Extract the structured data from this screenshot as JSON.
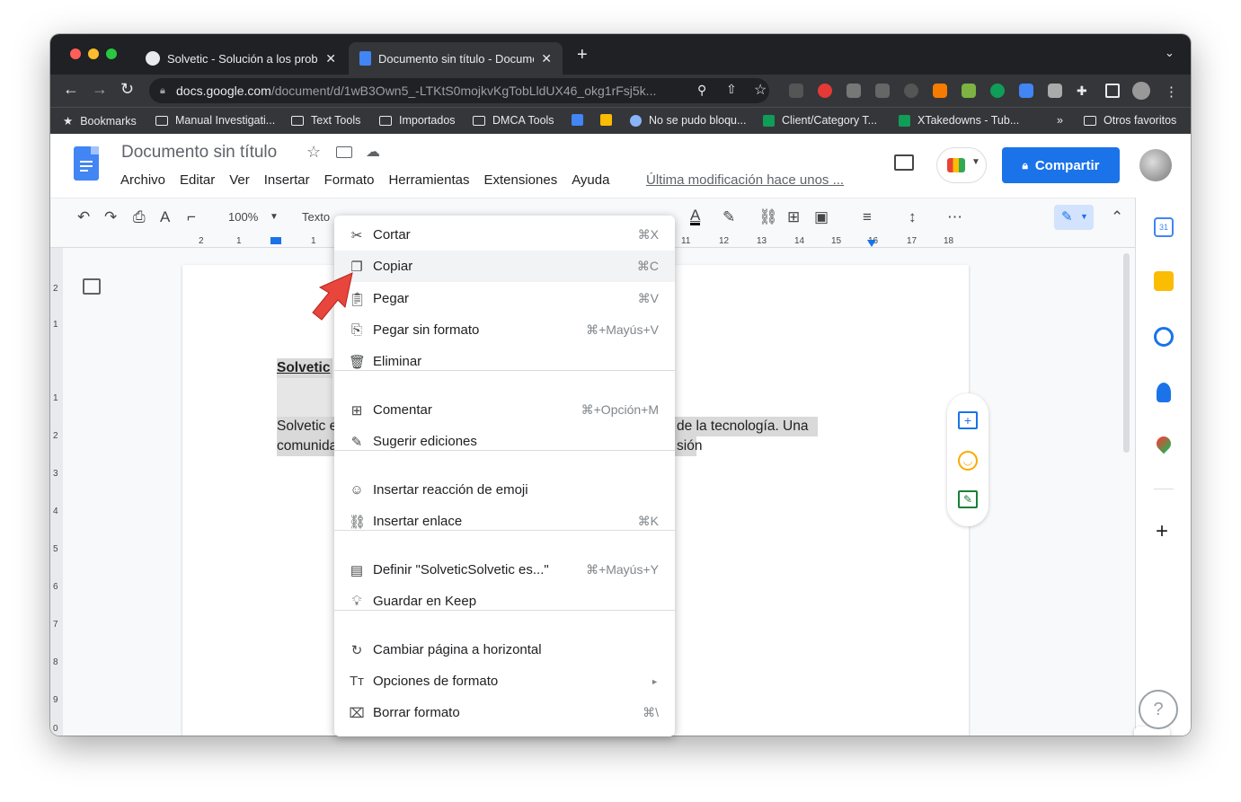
{
  "tabs": [
    {
      "label": "Solvetic - Solución a los proble"
    },
    {
      "label": "Documento sin título - Docume"
    }
  ],
  "address": {
    "host": "docs.google.com",
    "path": "/document/d/1wB3Own5_-LTKtS0mojkvKgTobLldUX46_okg1rFsj5k..."
  },
  "bookmarks": [
    "Bookmarks",
    "Manual Investigati...",
    "Text Tools",
    "Importados",
    "DMCA Tools",
    "No se pudo bloqu...",
    "Client/Category T...",
    "XTakedowns - Tub...",
    "»",
    "Otros favoritos"
  ],
  "doc": {
    "title": "Documento sin título",
    "menus": [
      "Archivo",
      "Editar",
      "Ver",
      "Insertar",
      "Formato",
      "Herramientas",
      "Extensiones",
      "Ayuda"
    ],
    "last_modified": "Última modificación hace unos ...",
    "share": "Compartir"
  },
  "toolbar": {
    "zoom": "100%",
    "style": "Texto"
  },
  "ruler": {
    "ticks_left": [
      "2",
      "1",
      "1"
    ],
    "ticks_right": [
      "11",
      "12",
      "13",
      "14",
      "15",
      "16",
      "17",
      "18"
    ],
    "vticks": [
      "2",
      "1",
      "1",
      "2",
      "3",
      "4",
      "5",
      "6",
      "7",
      "8",
      "9",
      "0"
    ]
  },
  "body": {
    "heading": "Solvetic",
    "line1_start": "Solvetic e",
    "line1_end": "de la tecnología. Una",
    "line2_start": "comunida",
    "line2_end": "sión"
  },
  "context_menu": [
    {
      "icon": "scissors",
      "label": "Cortar",
      "shortcut": "⌘X"
    },
    {
      "icon": "copy",
      "label": "Copiar",
      "shortcut": "⌘C"
    },
    {
      "icon": "paste",
      "label": "Pegar",
      "shortcut": "⌘V"
    },
    {
      "icon": "paste-plain",
      "label": "Pegar sin formato",
      "shortcut": "⌘+Mayús+V"
    },
    {
      "icon": "trash",
      "label": "Eliminar",
      "shortcut": ""
    },
    {
      "icon": "comment",
      "label": "Comentar",
      "shortcut": "⌘+Opción+M"
    },
    {
      "icon": "suggest",
      "label": "Sugerir ediciones",
      "shortcut": ""
    },
    {
      "icon": "emoji",
      "label": "Insertar reacción de emoji",
      "shortcut": ""
    },
    {
      "icon": "link",
      "label": "Insertar enlace",
      "shortcut": "⌘K"
    },
    {
      "icon": "define",
      "label": "Definir \"SolveticSolvetic es...\"",
      "shortcut": "⌘+Mayús+Y"
    },
    {
      "icon": "bulb",
      "label": "Guardar en Keep",
      "shortcut": ""
    },
    {
      "icon": "rotate",
      "label": "Cambiar página a horizontal",
      "shortcut": ""
    },
    {
      "icon": "format",
      "label": "Opciones de formato",
      "shortcut": "►"
    },
    {
      "icon": "clear-format",
      "label": "Borrar formato",
      "shortcut": "⌘\\"
    }
  ],
  "colors": {
    "accent": "#1a73e8",
    "arrow": "#e8453c"
  }
}
